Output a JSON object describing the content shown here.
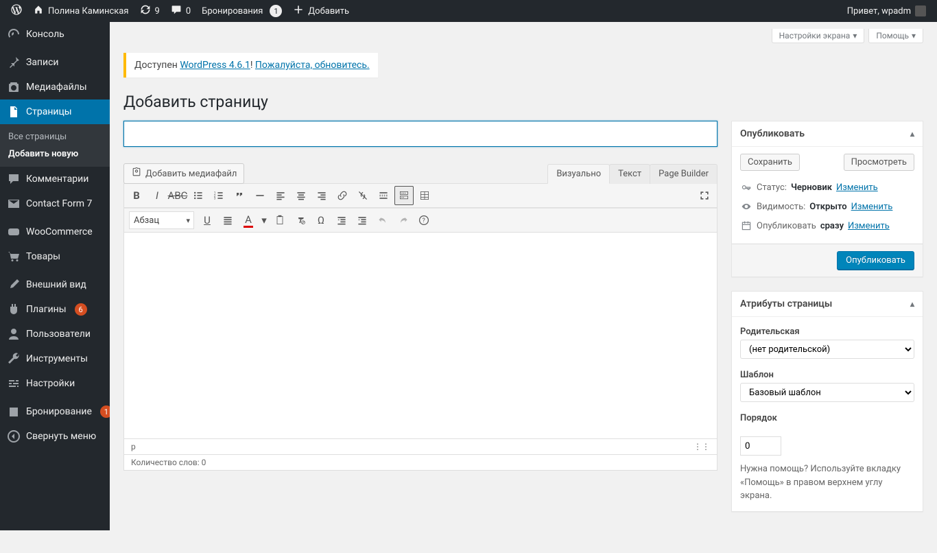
{
  "adminbar": {
    "site_name": "Полина Каминская",
    "updates_count": "9",
    "comments_count": "0",
    "bookings_label": "Бронирования",
    "bookings_count": "1",
    "add_new": "Добавить",
    "greeting": "Привет, wpadm"
  },
  "menu": {
    "dashboard": "Консоль",
    "posts": "Записи",
    "media": "Медиафайлы",
    "pages": "Страницы",
    "pages_sub_all": "Все страницы",
    "pages_sub_add": "Добавить новую",
    "comments": "Комментарии",
    "cf7": "Contact Form 7",
    "woocommerce": "WooCommerce",
    "products": "Товары",
    "appearance": "Внешний вид",
    "plugins": "Плагины",
    "plugins_count": "6",
    "users": "Пользователи",
    "tools": "Инструменты",
    "settings": "Настройки",
    "booking": "Бронирование",
    "booking_count": "1",
    "collapse": "Свернуть меню"
  },
  "screen_meta": {
    "options": "Настройки экрана",
    "help": "Помощь"
  },
  "update_nag": {
    "prefix": "Доступен ",
    "link1": "WordPress 4.6.1",
    "mid": "! ",
    "link2": "Пожалуйста, обновитесь.",
    "suffix": ""
  },
  "page": {
    "heading": "Добавить страницу",
    "title_value": "",
    "title_placeholder": "",
    "add_media": "Добавить медиафайл",
    "tabs": {
      "visual": "Визуально",
      "text": "Текст",
      "pb": "Page Builder"
    },
    "format_select": "Абзац",
    "status_path": "p",
    "word_count_label": "Количество слов: ",
    "word_count_value": "0"
  },
  "publish": {
    "title": "Опубликовать",
    "save_draft": "Сохранить",
    "preview": "Просмотреть",
    "status_label": "Статус:",
    "status_value": "Черновик",
    "visibility_label": "Видимость:",
    "visibility_value": "Открыто",
    "schedule_label": "Опубликовать",
    "schedule_value": "сразу",
    "edit": "Изменить",
    "publish_btn": "Опубликовать"
  },
  "attributes": {
    "title": "Атрибуты страницы",
    "parent_label": "Родительская",
    "parent_value": "(нет родительской)",
    "template_label": "Шаблон",
    "template_value": "Базовый шаблон",
    "order_label": "Порядок",
    "order_value": "0",
    "help": "Нужна помощь? Используйте вкладку «Помощь» в правом верхнем углу экрана."
  }
}
